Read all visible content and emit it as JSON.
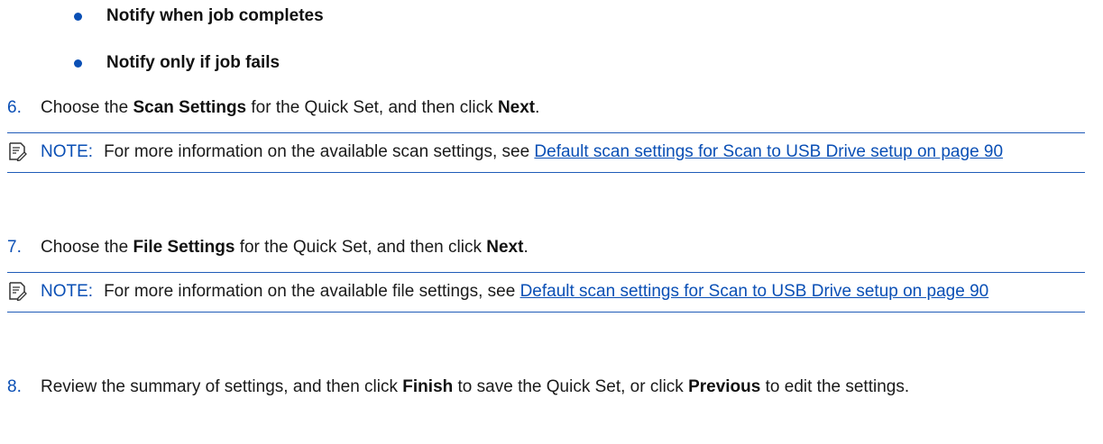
{
  "bullets": [
    "Notify when job completes",
    "Notify only if job fails"
  ],
  "steps": [
    {
      "num": "6.",
      "pre": "Choose the ",
      "bold1": "Scan Settings",
      "mid": " for the Quick Set, and then click ",
      "bold2": "Next",
      "post": "."
    },
    {
      "num": "7.",
      "pre": "Choose the ",
      "bold1": "File Settings",
      "mid": " for the Quick Set, and then click ",
      "bold2": "Next",
      "post": "."
    },
    {
      "num": "8.",
      "pre": "Review the summary of settings, and then click ",
      "bold1": "Finish",
      "mid": " to save the Quick Set, or click ",
      "bold2": "Previous",
      "post": " to edit the settings."
    }
  ],
  "notes": [
    {
      "label": "NOTE:",
      "text": "For more information on the available scan settings, see ",
      "link": "Default scan settings for Scan to USB Drive setup on page 90",
      "icon": "note-icon"
    },
    {
      "label": "NOTE:",
      "text": "For more information on the available file settings, see ",
      "link": "Default scan settings for Scan to USB Drive setup on page 90",
      "icon": "note-icon"
    }
  ],
  "colors": {
    "accent": "#0a4fb5",
    "rule": "#1f5bb8"
  }
}
